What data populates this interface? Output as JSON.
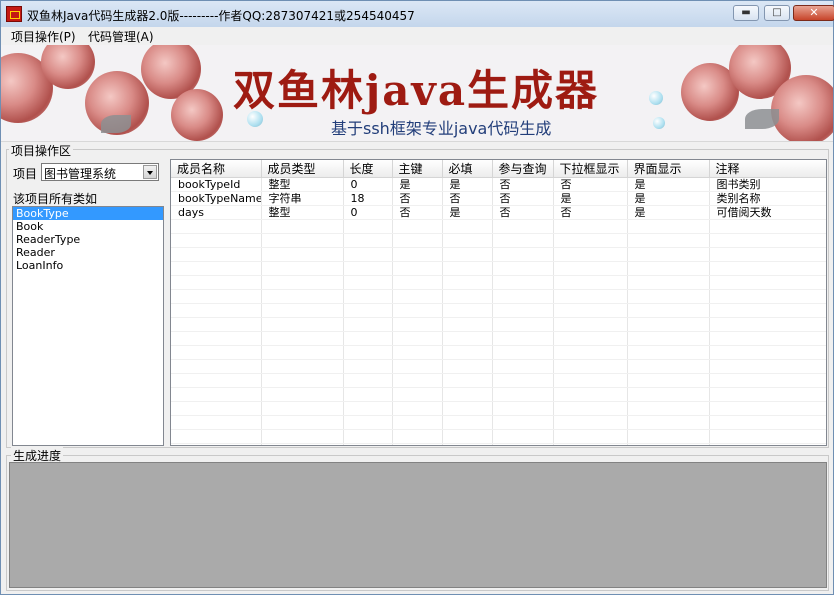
{
  "window": {
    "title": "双鱼林Java代码生成器2.0版---------作者QQ:287307421或254540457",
    "minimize_icon": "minimize-icon",
    "maximize_icon": "maximize-icon",
    "close_icon": "close-icon"
  },
  "menu": {
    "items": [
      {
        "label": "项目操作(P)"
      },
      {
        "label": "代码管理(A)"
      }
    ]
  },
  "banner": {
    "title": "双鱼林java生成器",
    "subtitle": "基于ssh框架专业java代码生成",
    "title_color": "#9e1b12",
    "subtitle_color": "#223e7a"
  },
  "project_area": {
    "group_label": "项目操作区",
    "project_label": "项目",
    "project_selected": "图书管理系统",
    "classes_label": "该项目所有类如",
    "classes": [
      "BookType",
      "Book",
      "ReaderType",
      "Reader",
      "LoanInfo"
    ],
    "selected_class": "BookType"
  },
  "fields_table": {
    "columns": [
      "成员名称",
      "成员类型",
      "长度",
      "主键",
      "必填",
      "参与查询",
      "下拉框显示",
      "界面显示",
      "注释"
    ],
    "rows": [
      [
        "bookTypeId",
        "整型",
        "0",
        "是",
        "是",
        "否",
        "否",
        "是",
        "图书类别"
      ],
      [
        "bookTypeName",
        "字符串",
        "18",
        "否",
        "否",
        "否",
        "是",
        "是",
        "类别名称"
      ],
      [
        "days",
        "整型",
        "0",
        "否",
        "是",
        "否",
        "否",
        "是",
        "可借阅天数"
      ]
    ]
  },
  "progress": {
    "group_label": "生成进度"
  }
}
